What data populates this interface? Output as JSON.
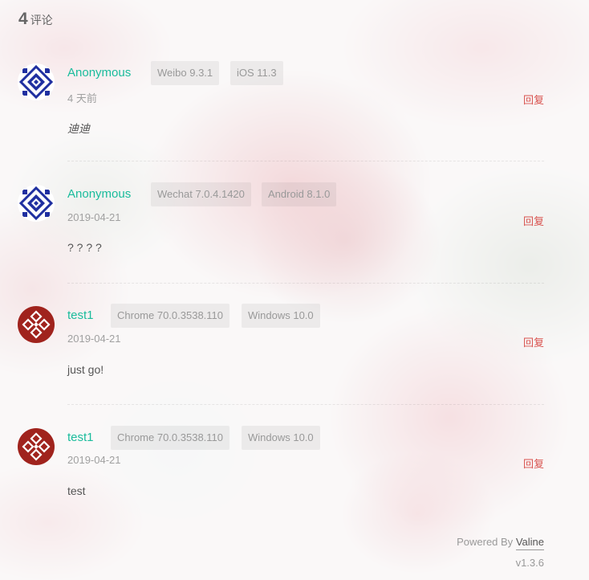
{
  "header": {
    "count": "4",
    "label": "评论"
  },
  "comments": [
    {
      "nick": "Anonymous",
      "avatar": "blue-geometric-avatar",
      "badges": [
        "Weibo 9.3.1",
        "iOS 11.3"
      ],
      "time": "4 天前",
      "reply": "回复",
      "text": "迪迪"
    },
    {
      "nick": "Anonymous",
      "avatar": "blue-geometric-avatar",
      "badges": [
        "Wechat 7.0.4.1420",
        "Android 8.1.0"
      ],
      "time": "2019-04-21",
      "reply": "回复",
      "text": "? ? ? ?"
    },
    {
      "nick": "test1",
      "avatar": "red-geometric-avatar",
      "badges": [
        "Chrome 70.0.3538.110",
        "Windows 10.0"
      ],
      "time": "2019-04-21",
      "reply": "回复",
      "text": "just go!"
    },
    {
      "nick": "test1",
      "avatar": "red-geometric-avatar",
      "badges": [
        "Chrome 70.0.3538.110",
        "Windows 10.0"
      ],
      "time": "2019-04-21",
      "reply": "回复",
      "text": "test"
    }
  ],
  "footer": {
    "powered_prefix": "Powered By",
    "powered_brand": "Valine",
    "version": "v1.3.6"
  },
  "colors": {
    "nick_green": "#1abc9c",
    "reply_red": "#d9534f",
    "avatar_blue": "#1f2fa0",
    "avatar_red": "#a0231d"
  }
}
